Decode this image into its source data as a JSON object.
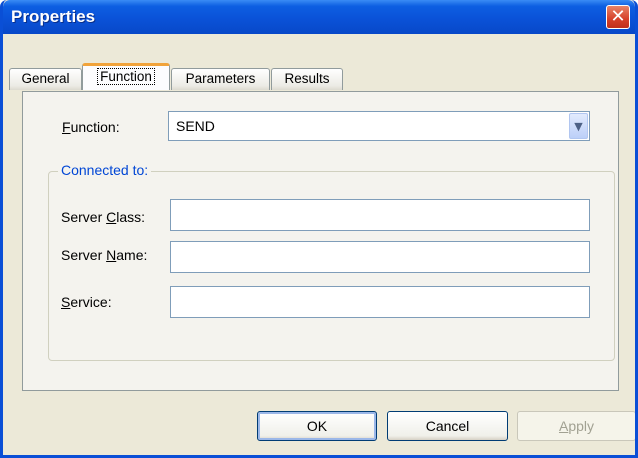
{
  "window": {
    "title": "Properties",
    "close_glyph": "✕"
  },
  "tabs": [
    {
      "label": "General",
      "active": false
    },
    {
      "label": "Function",
      "active": true
    },
    {
      "label": "Parameters",
      "active": false
    },
    {
      "label": "Results",
      "active": false
    }
  ],
  "function_field": {
    "label_mnemonic": "F",
    "label_rest": "unction:",
    "value": "SEND",
    "dropdown_icon": "chevron-down-icon"
  },
  "connected_group": {
    "label": "Connected to:",
    "server_class": {
      "label_pre": "Server ",
      "label_mnemonic": "C",
      "label_post": "lass:",
      "value": ""
    },
    "server_name": {
      "label_pre": "Server ",
      "label_mnemonic": "N",
      "label_post": "ame:",
      "value": ""
    },
    "service": {
      "label_pre": "",
      "label_mnemonic": "S",
      "label_post": "ervice:",
      "value": ""
    }
  },
  "buttons": {
    "ok": "OK",
    "cancel": "Cancel",
    "apply_mnemonic": "A",
    "apply_rest": "pply"
  },
  "colors": {
    "titlebar": "#0a52d8",
    "group_label": "#0046d5",
    "active_tab_accent": "#f1a33a",
    "close_button": "#d6402a"
  }
}
